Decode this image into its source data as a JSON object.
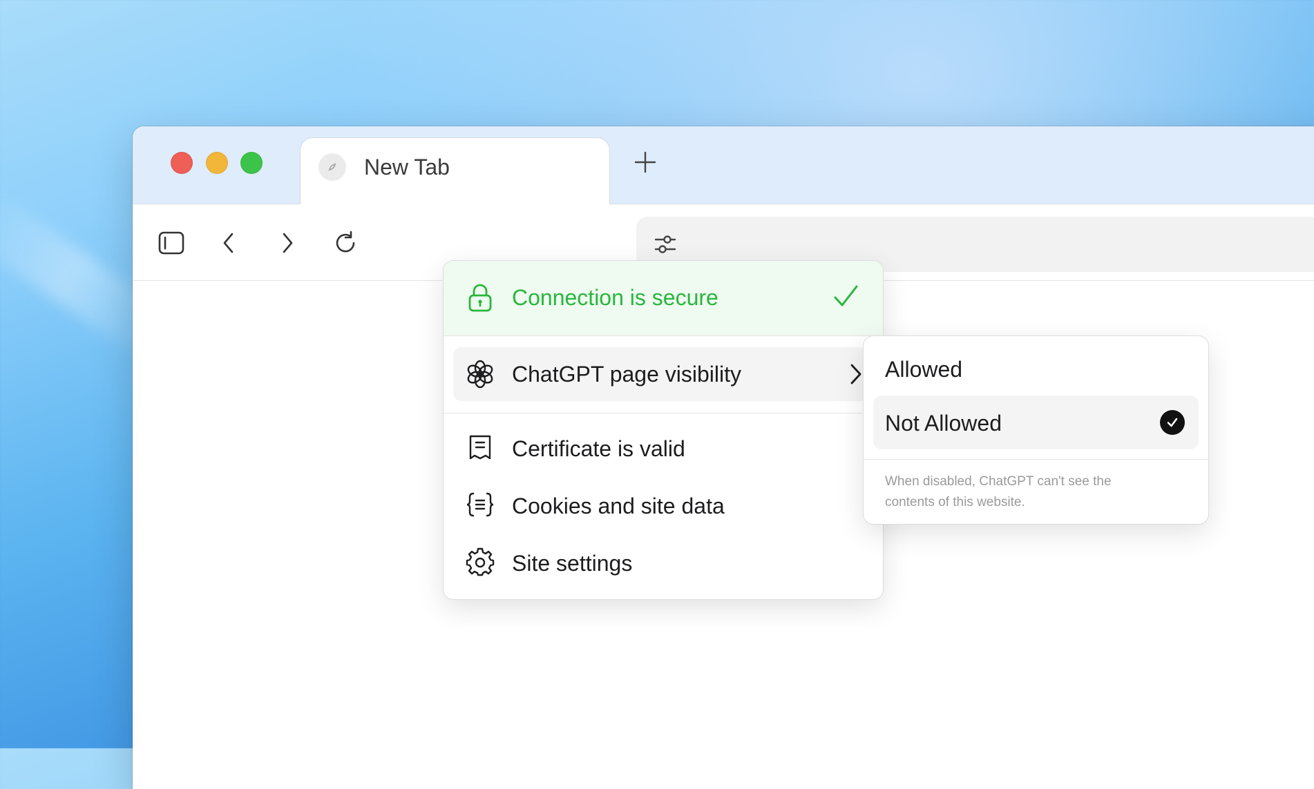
{
  "tab": {
    "title": "New Tab"
  },
  "toolbar": {
    "icons": [
      "sidebar-icon",
      "back-icon",
      "forward-icon",
      "reload-icon",
      "site-controls-icon"
    ]
  },
  "site_info_popup": {
    "secure_label": "Connection is secure",
    "secure_color": "#29b63e",
    "visibility_label": "ChatGPT page visibility",
    "certificate_label": "Certificate is valid",
    "cookies_label": "Cookies and site data",
    "settings_label": "Site settings"
  },
  "visibility_submenu": {
    "options": [
      {
        "label": "Allowed",
        "selected": false
      },
      {
        "label": "Not Allowed",
        "selected": true
      }
    ],
    "note": "When disabled, ChatGPT can't see the contents of this website."
  }
}
